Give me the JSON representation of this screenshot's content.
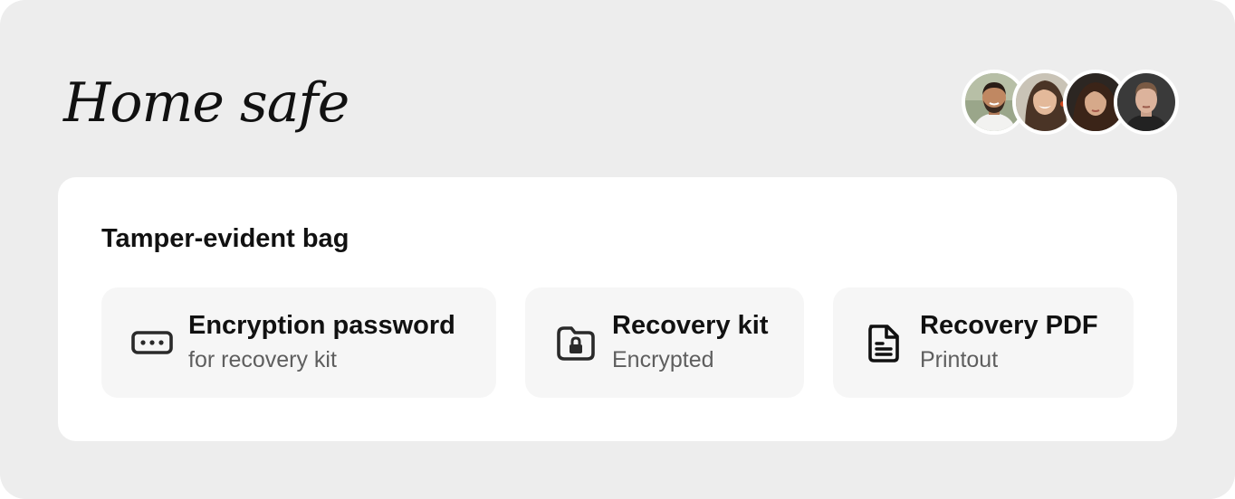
{
  "safe": {
    "title": "Home safe"
  },
  "members": [
    {
      "name": "member-1"
    },
    {
      "name": "member-2"
    },
    {
      "name": "member-3"
    },
    {
      "name": "member-4"
    }
  ],
  "bag": {
    "title": "Tamper-evident bag",
    "items": [
      {
        "title": "Encryption password",
        "subtitle": "for recovery kit",
        "icon": "password-dots-icon"
      },
      {
        "title": "Recovery kit",
        "subtitle": "Encrypted",
        "icon": "locked-folder-icon"
      },
      {
        "title": "Recovery PDF",
        "subtitle": "Printout",
        "icon": "document-icon"
      }
    ]
  }
}
